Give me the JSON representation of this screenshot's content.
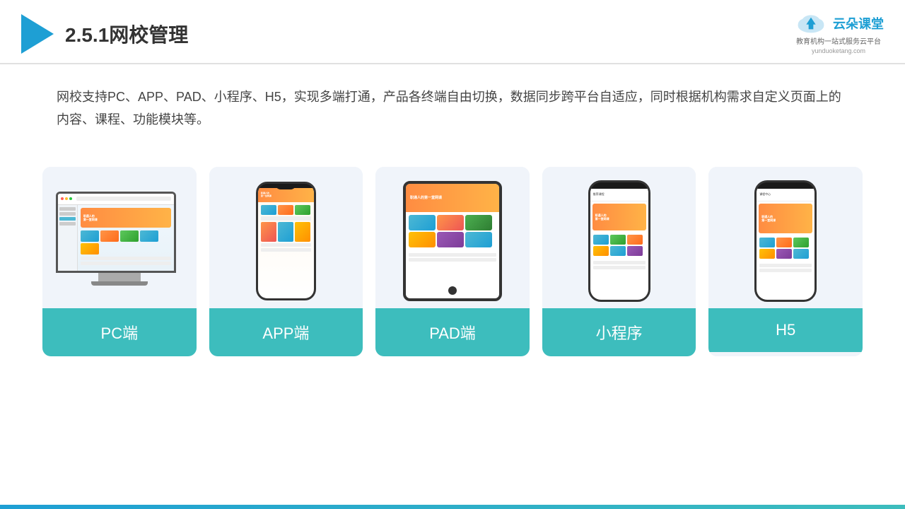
{
  "header": {
    "title": "2.5.1网校管理",
    "title_num": "2.5.1",
    "title_chinese": "网校管理"
  },
  "brand": {
    "name": "云朵课堂",
    "tagline": "教育机构一站\n式服务云平台",
    "url": "yunduoketang.com"
  },
  "description": {
    "text": "网校支持PC、APP、PAD、小程序、H5，实现多端打通，产品各终端自由切换，数据同步跨平台自适应，同时根据机构需求自定义页面上的内容、课程、功能模块等。"
  },
  "cards": [
    {
      "id": "pc",
      "label": "PC端"
    },
    {
      "id": "app",
      "label": "APP端"
    },
    {
      "id": "pad",
      "label": "PAD端"
    },
    {
      "id": "miniprogram",
      "label": "小程序"
    },
    {
      "id": "h5",
      "label": "H5"
    }
  ]
}
